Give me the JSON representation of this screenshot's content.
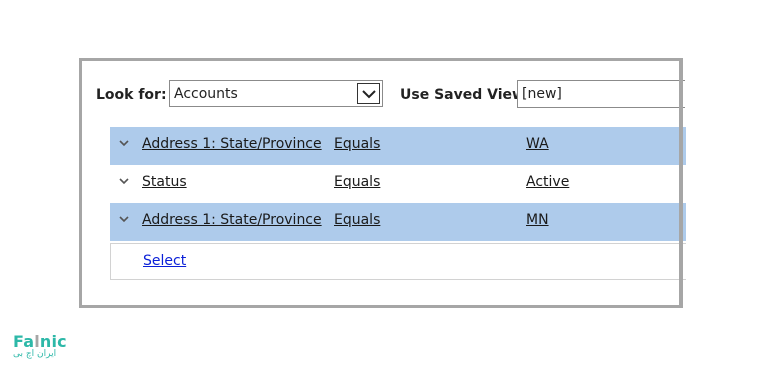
{
  "toolbar": {
    "look_for_label": "Look for:",
    "look_for_value": "Accounts",
    "saved_view_label": "Use Saved View:",
    "saved_view_value": "[new]"
  },
  "filter_rows": [
    {
      "field": "Address 1: State/Province",
      "operator": "Equals",
      "value": "WA",
      "highlighted": true
    },
    {
      "field": "Status",
      "operator": "Equals",
      "value": "Active",
      "highlighted": false
    },
    {
      "field": "Address 1: State/Province",
      "operator": "Equals",
      "value": "MN",
      "highlighted": true
    }
  ],
  "select_link": "Select",
  "watermark": {
    "brand_fa": "Fa",
    "brand_l": "l",
    "brand_nic": "nic",
    "sub": "ایران اچ بی"
  },
  "colors": {
    "highlight_row": "#aecbeb",
    "frame_border": "#a6a6a6",
    "link": "#0b20d8",
    "brand": "#2db8a8"
  },
  "icons": {
    "dropdown": "chevron-down-icon",
    "row_expand": "chevron-down-icon"
  }
}
